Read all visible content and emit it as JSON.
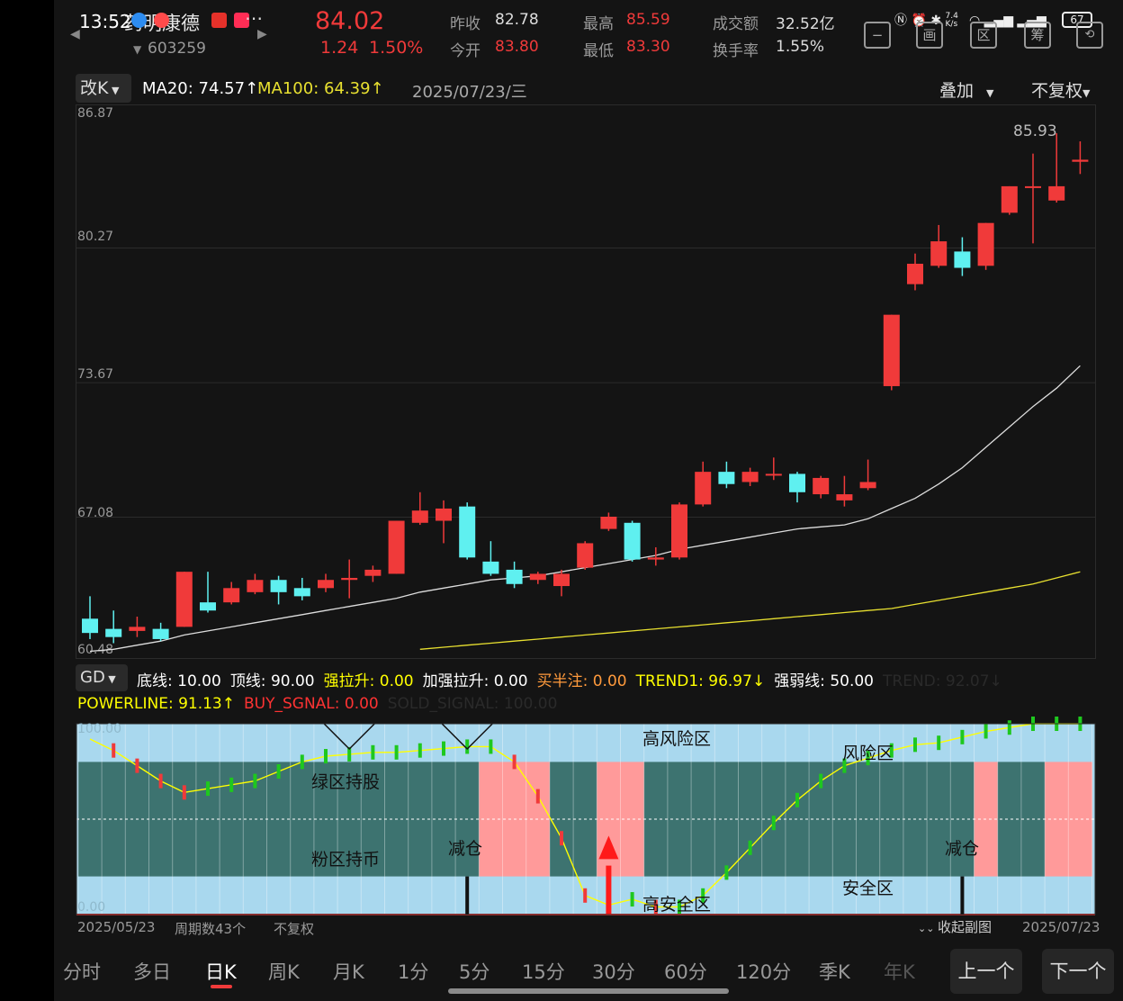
{
  "status": {
    "time": "13:52",
    "net_speed": "7.4 K/s",
    "battery": "67"
  },
  "stock": {
    "name": "药明康德",
    "code": "603259",
    "price": "84.02",
    "change": "1.24",
    "change_pct": "1.50%"
  },
  "quote": {
    "prev_close_label": "昨收",
    "prev_close": "82.78",
    "open_label": "今开",
    "open": "83.80",
    "high_label": "最高",
    "high": "85.59",
    "low_label": "最低",
    "low": "83.30",
    "turnover_label": "成交额",
    "turnover": "32.52亿",
    "rate_label": "换手率",
    "rate": "1.55%"
  },
  "side_buttons": [
    "画",
    "区",
    "筹"
  ],
  "kline_bar": {
    "mode": "改K",
    "ma20": "MA20: 74.57↑",
    "ma100": "MA100: 64.39↑",
    "date": "2025/07/23/三",
    "overlay": "叠加",
    "adjust": "不复权"
  },
  "price_axis": [
    "86.87",
    "80.27",
    "73.67",
    "67.08",
    "60.48"
  ],
  "max_label": "85.93",
  "indicator": {
    "name": "GD",
    "line1": [
      {
        "t": "底线: 10.00",
        "c": "#ffffff"
      },
      {
        "t": "顶线: 90.00",
        "c": "#ffffff"
      },
      {
        "t": "强拉升: 0.00",
        "c": "#ffff00"
      },
      {
        "t": "加强拉升: 0.00",
        "c": "#ffffff"
      },
      {
        "t": "买半注: 0.00",
        "c": "#ff9a3c"
      },
      {
        "t": "TREND1: 96.97↓",
        "c": "#ffff00"
      },
      {
        "t": "强弱线: 50.00",
        "c": "#ffffff"
      },
      {
        "t": "TREND: 92.07↓",
        "c": "#2a2a2a"
      }
    ],
    "line2": [
      {
        "t": "POWERLINE: 91.13↑",
        "c": "#ffff00"
      },
      {
        "t": "BUY_SGNAL: 0.00",
        "c": "#ff3333"
      },
      {
        "t": "SOLD_SIGNAL: 100.00",
        "c": "#2a2a2a"
      }
    ]
  },
  "zones": {
    "high_risk": "高风险区",
    "risk": "风险区",
    "green_hold": "绿区持股",
    "pink_hold": "粉区持币",
    "reduce": "减仓",
    "safe": "安全区",
    "high_safe": "高安全区",
    "top_val": "100.00",
    "bottom_val": "0.00"
  },
  "footer": {
    "start_date": "2025/05/23",
    "periods": "周期数43个",
    "adjust": "不复权",
    "collapse": "收起副图",
    "end_date": "2025/07/23"
  },
  "tabs": [
    "分时",
    "多日",
    "日K",
    "周K",
    "月K",
    "1分",
    "5分",
    "15分",
    "30分",
    "60分",
    "120分",
    "季K",
    "年K"
  ],
  "active_tab": "日K",
  "prev_button": "上一个",
  "next_button": "下一个",
  "colors": {
    "up": "#f03a3a",
    "down": "#5ff0f0",
    "ma20": "#dddddd",
    "ma100": "#e8e030",
    "green_zone": "#3d7370",
    "pink_zone": "#ff9a9a",
    "blue_zone": "#a9d8ee"
  },
  "chart_data": {
    "type": "candlestick",
    "title": "",
    "ylim": [
      60.48,
      86.87
    ],
    "candles": [
      {
        "o": 62.1,
        "c": 61.4,
        "h": 63.2,
        "l": 61.1
      },
      {
        "o": 61.6,
        "c": 61.2,
        "h": 62.5,
        "l": 60.9
      },
      {
        "o": 61.5,
        "c": 61.7,
        "h": 62.2,
        "l": 61.2
      },
      {
        "o": 61.6,
        "c": 61.1,
        "h": 61.9,
        "l": 61.0
      },
      {
        "o": 61.7,
        "c": 64.4,
        "h": 64.4,
        "l": 61.7
      },
      {
        "o": 62.9,
        "c": 62.5,
        "h": 64.4,
        "l": 62.4
      },
      {
        "o": 62.9,
        "c": 63.6,
        "h": 63.9,
        "l": 62.8
      },
      {
        "o": 63.4,
        "c": 64.0,
        "h": 64.3,
        "l": 63.3
      },
      {
        "o": 64.0,
        "c": 63.4,
        "h": 64.2,
        "l": 62.8
      },
      {
        "o": 63.6,
        "c": 63.2,
        "h": 64.1,
        "l": 63.0
      },
      {
        "o": 63.6,
        "c": 64.0,
        "h": 64.3,
        "l": 63.4
      },
      {
        "o": 64.0,
        "c": 64.1,
        "h": 65.0,
        "l": 63.1
      },
      {
        "o": 64.2,
        "c": 64.5,
        "h": 64.7,
        "l": 63.9
      },
      {
        "o": 64.3,
        "c": 66.9,
        "h": 66.9,
        "l": 64.3
      },
      {
        "o": 66.8,
        "c": 67.4,
        "h": 68.3,
        "l": 66.7
      },
      {
        "o": 66.9,
        "c": 67.5,
        "h": 67.9,
        "l": 65.8
      },
      {
        "o": 67.6,
        "c": 65.1,
        "h": 67.8,
        "l": 65.0
      },
      {
        "o": 64.9,
        "c": 64.3,
        "h": 65.9,
        "l": 64.2
      },
      {
        "o": 64.5,
        "c": 63.8,
        "h": 64.9,
        "l": 63.6
      },
      {
        "o": 64.0,
        "c": 64.3,
        "h": 64.4,
        "l": 63.8
      },
      {
        "o": 63.7,
        "c": 64.3,
        "h": 64.5,
        "l": 63.2
      },
      {
        "o": 64.6,
        "c": 65.8,
        "h": 65.9,
        "l": 64.5
      },
      {
        "o": 66.5,
        "c": 67.1,
        "h": 67.3,
        "l": 66.4
      },
      {
        "o": 66.8,
        "c": 65.0,
        "h": 66.9,
        "l": 64.9
      },
      {
        "o": 65.0,
        "c": 65.1,
        "h": 65.6,
        "l": 64.7
      },
      {
        "o": 65.1,
        "c": 67.7,
        "h": 67.8,
        "l": 65.0
      },
      {
        "o": 67.7,
        "c": 69.3,
        "h": 69.8,
        "l": 67.6
      },
      {
        "o": 69.3,
        "c": 68.7,
        "h": 69.8,
        "l": 68.5
      },
      {
        "o": 68.8,
        "c": 69.3,
        "h": 69.5,
        "l": 68.6
      },
      {
        "o": 69.2,
        "c": 69.2,
        "h": 70.0,
        "l": 68.9
      },
      {
        "o": 69.2,
        "c": 68.3,
        "h": 69.3,
        "l": 67.8
      },
      {
        "o": 68.2,
        "c": 69.0,
        "h": 69.1,
        "l": 68.0
      },
      {
        "o": 67.9,
        "c": 68.2,
        "h": 69.1,
        "l": 67.6
      },
      {
        "o": 68.5,
        "c": 68.8,
        "h": 69.9,
        "l": 68.4
      },
      {
        "o": 73.5,
        "c": 77.0,
        "h": 77.0,
        "l": 73.3
      },
      {
        "o": 78.5,
        "c": 79.5,
        "h": 80.0,
        "l": 78.2
      },
      {
        "o": 79.4,
        "c": 80.6,
        "h": 81.4,
        "l": 79.3
      },
      {
        "o": 80.1,
        "c": 79.3,
        "h": 80.8,
        "l": 78.9
      },
      {
        "o": 79.4,
        "c": 81.5,
        "h": 81.5,
        "l": 79.2
      },
      {
        "o": 82.0,
        "c": 83.3,
        "h": 83.3,
        "l": 81.9
      },
      {
        "o": 83.3,
        "c": 83.3,
        "h": 84.9,
        "l": 80.5
      },
      {
        "o": 82.6,
        "c": 83.3,
        "h": 85.9,
        "l": 82.5
      },
      {
        "o": 84.5,
        "c": 84.6,
        "h": 85.5,
        "l": 83.9
      }
    ],
    "ma20": [
      60.5,
      60.6,
      60.8,
      61.0,
      61.3,
      61.5,
      61.7,
      61.9,
      62.1,
      62.3,
      62.5,
      62.7,
      62.9,
      63.1,
      63.4,
      63.6,
      63.8,
      64.0,
      64.1,
      64.2,
      64.4,
      64.6,
      64.8,
      65.0,
      65.2,
      65.5,
      65.7,
      65.9,
      66.1,
      66.3,
      66.5,
      66.6,
      66.7,
      67.0,
      67.5,
      68.0,
      68.7,
      69.5,
      70.5,
      71.5,
      72.5,
      73.4,
      74.5
    ],
    "ma100": [
      null,
      null,
      null,
      null,
      null,
      null,
      null,
      null,
      null,
      null,
      null,
      null,
      null,
      null,
      60.6,
      60.7,
      60.8,
      60.9,
      61.0,
      61.1,
      61.2,
      61.3,
      61.4,
      61.5,
      61.6,
      61.7,
      61.8,
      61.9,
      62.0,
      62.1,
      62.2,
      62.3,
      62.4,
      62.5,
      62.6,
      62.8,
      63.0,
      63.2,
      63.4,
      63.6,
      63.8,
      64.1,
      64.4
    ],
    "sub_ylim": [
      0,
      100
    ],
    "trend": [
      92,
      86,
      78,
      70,
      64,
      66,
      68,
      70,
      75,
      80,
      83,
      84,
      85,
      85,
      86,
      87,
      88,
      88,
      80,
      62,
      40,
      10,
      5,
      8,
      4,
      4,
      10,
      22,
      35,
      48,
      60,
      70,
      78,
      82,
      86,
      89,
      90,
      93,
      96,
      98,
      100,
      100,
      100
    ],
    "zone_pattern": [
      "g",
      "g",
      "g",
      "g",
      "g",
      "g",
      "g",
      "g",
      "g",
      "g",
      "g",
      "g",
      "g",
      "g",
      "g",
      "g",
      "g",
      "p",
      "p",
      "p",
      "g",
      "g",
      "p",
      "p",
      "g",
      "g",
      "g",
      "g",
      "g",
      "g",
      "g",
      "g",
      "g",
      "g",
      "g",
      "g",
      "g",
      "g",
      "p",
      "g",
      "g",
      "p",
      "p"
    ]
  }
}
